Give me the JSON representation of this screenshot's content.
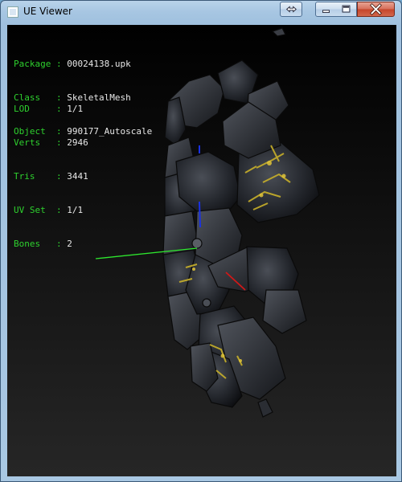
{
  "window": {
    "title": "UE Viewer"
  },
  "colors": {
    "info_label": "#2ed12e",
    "info_value": "#e8e8e8",
    "axis_x": "#d01818",
    "axis_y": "#2ee82e",
    "axis_z": "#1a32e6"
  },
  "info": {
    "rows": [
      {
        "label": "Package",
        "value": "00024138.upk"
      },
      {
        "label": "Class",
        "value": "SkeletalMesh"
      },
      {
        "label": "Object",
        "value": "990177_Autoscale"
      }
    ],
    "stats": [
      {
        "label": "LOD",
        "value": "1/1"
      },
      {
        "label": "Verts",
        "value": "2946"
      },
      {
        "label": "Tris",
        "value": "3441"
      },
      {
        "label": "UV Set",
        "value": "1/1"
      },
      {
        "label": "Bones",
        "value": "2"
      }
    ]
  },
  "icons": {
    "window": "app-icon",
    "restore": "swap-arrows-icon",
    "minimize": "minimize-icon",
    "maximize": "maximize-icon",
    "close": "close-icon"
  }
}
